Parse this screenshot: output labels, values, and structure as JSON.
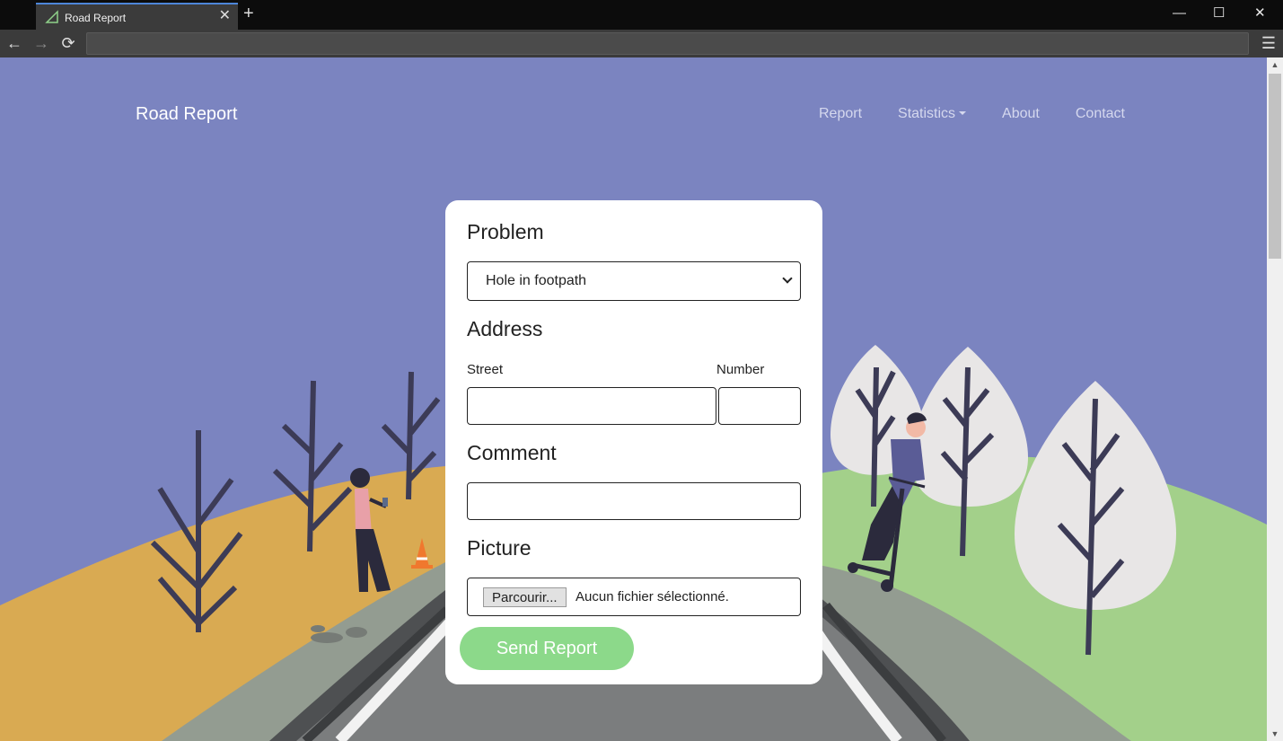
{
  "browser": {
    "tab_title": "Road Report",
    "tab_close": "✕",
    "new_tab": "+",
    "url": "",
    "window_controls": {
      "minimize": "—",
      "maximize": "☐",
      "close": "✕"
    },
    "nav": {
      "back": "←",
      "forward": "→",
      "reload": "⟳",
      "menu": "☰"
    }
  },
  "site": {
    "brand": "Road Report",
    "nav": [
      {
        "label": "Report"
      },
      {
        "label": "Statistics",
        "dropdown": true
      },
      {
        "label": "About"
      },
      {
        "label": "Contact"
      }
    ]
  },
  "form": {
    "problem_heading": "Problem",
    "problem_selected": "Hole in footpath",
    "address_heading": "Address",
    "street_label": "Street",
    "number_label": "Number",
    "street_value": "",
    "number_value": "",
    "comment_heading": "Comment",
    "comment_value": "",
    "picture_heading": "Picture",
    "file_button": "Parcourir...",
    "file_status": "Aucun fichier sélectionné.",
    "submit_label": "Send Report"
  },
  "colors": {
    "sky": "#7b84c0",
    "left_hill": "#d9aa52",
    "right_hill": "#a3d08a",
    "road": "#7b7d7e",
    "submit": "#8cd98a",
    "tab_accent": "#4d86d9"
  },
  "icons": [
    "tab-logo-icon",
    "close-icon",
    "plus-icon",
    "back-arrow-icon",
    "forward-arrow-icon",
    "reload-icon",
    "menu-icon",
    "chevron-down-icon",
    "caret-down-icon"
  ]
}
